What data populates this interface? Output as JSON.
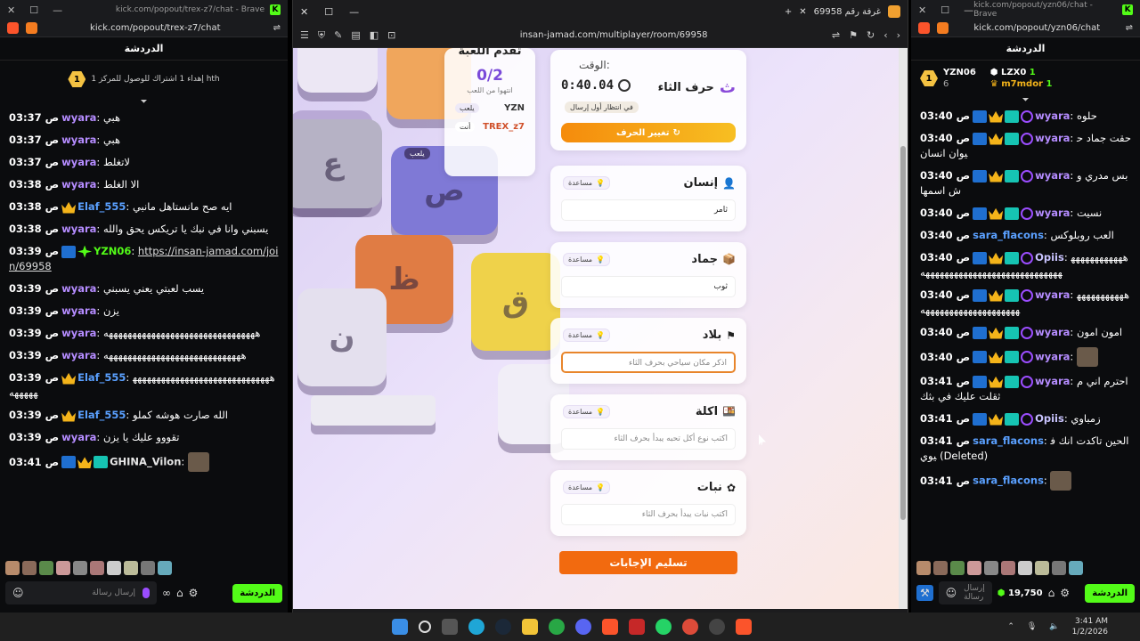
{
  "left_chat": {
    "window_title": "kick.com/popout/trex-z7/chat - Brave",
    "url": "kick.com/popout/trex-z7/chat",
    "header": "الدردشة",
    "pinned_rank": "1",
    "pinned_text": "إهداء 1 اشتراك للوصول للمركز 1 hth",
    "messages": [
      {
        "time": "03:37 ص",
        "user": "wyara",
        "text": "هبي"
      },
      {
        "time": "03:37 ص",
        "user": "wyara",
        "text": "هبي"
      },
      {
        "time": "03:37 ص",
        "user": "wyara",
        "text": "لاتغلط"
      },
      {
        "time": "03:38 ص",
        "user": "wyara",
        "text": "الا الغلط"
      },
      {
        "time": "03:38 ص",
        "user": "Elaf_555",
        "text": "ايه صح مانستاهل مانبي"
      },
      {
        "time": "03:38 ص",
        "user": "wyara",
        "text": "يسبني وانا في نبك يا تريكس يحق والله"
      },
      {
        "time": "03:39 ص",
        "user": "YZN06",
        "text": "https://insan-jamad.com/join/69958"
      },
      {
        "time": "03:39 ص",
        "user": "wyara",
        "text": "يسب لعبتي يعني يسبني"
      },
      {
        "time": "03:39 ص",
        "user": "wyara",
        "text": "يزن"
      },
      {
        "time": "03:39 ص",
        "user": "wyara",
        "text": "ههههههههههههههههههههههههههههههههه"
      },
      {
        "time": "03:39 ص",
        "user": "wyara",
        "text": "هههههههههههههههههههههههههههههه"
      },
      {
        "time": "03:39 ص",
        "user": "Elaf_555",
        "text": "هههههههههههههههههههههههههههههههههههه"
      },
      {
        "time": "03:39 ص",
        "user": "Elaf_555",
        "text": "الله صارت هوشه كملو"
      },
      {
        "time": "03:39 ص",
        "user": "wyara",
        "text": "تقووو عليك يا يزن"
      },
      {
        "time": "03:41 ص",
        "user": "GHINA_Vilon",
        "text": ""
      }
    ],
    "input_placeholder": "إرسال رسالة",
    "send_label": "الدردشة"
  },
  "browser": {
    "tab_title": "غرفة رقم 69958",
    "address": "insan-jamad.com/multiplayer/room/69958"
  },
  "game": {
    "progress_title": "تقدم اللعبة",
    "progress_score": "0/2",
    "progress_sub": "انتهوا من اللعب",
    "players": [
      {
        "name": "YZN",
        "status": "يلعب"
      },
      {
        "name": "TREX_z7",
        "status": "أنت"
      }
    ],
    "floating_status": "يلعب",
    "time_label": "الوقت:",
    "time_value": "0:40.04",
    "letter_title": "حرف الثاء",
    "letter_glyph": "ث",
    "waiting_text": "في انتظار أول إرسال",
    "change_letter": "تغيير الحرف",
    "help_label": "مساعدة",
    "categories": [
      {
        "title": "إنسان",
        "icon": "person-icon",
        "value": "ثامر",
        "placeholder": ""
      },
      {
        "title": "جماد",
        "icon": "box-icon",
        "value": "ثوب",
        "placeholder": ""
      },
      {
        "title": "بلاد",
        "icon": "flag-icon",
        "value": "",
        "placeholder": "اذكر مكان سياحي بحرف الثاء"
      },
      {
        "title": "اكلة",
        "icon": "food-icon",
        "value": "",
        "placeholder": "اكتب نوع أكل تحبه يبدأ بحرف الثاء"
      },
      {
        "title": "نبات",
        "icon": "plant-icon",
        "value": "",
        "placeholder": "اكتب نبات يبدأ بحرف الثاء"
      }
    ],
    "submit_label": "تسليم الإجابات",
    "key_letters": [
      "ع",
      "ص",
      "ظ",
      "ق",
      "ن"
    ]
  },
  "right_chat": {
    "window_title": "kick.com/popout/yzn06/chat - Brave",
    "url": "kick.com/popout/yzn06/chat",
    "header": "الدردشة",
    "leaderboard": [
      {
        "rank": "1",
        "name": "YZN06",
        "count": "6"
      },
      {
        "name": "LZX0",
        "count": "1"
      },
      {
        "name": "m7mdor",
        "count": "1"
      }
    ],
    "messages": [
      {
        "time": "03:40 ص",
        "user": "wyara",
        "text": "حلوه"
      },
      {
        "time": "03:40 ص",
        "user": "wyara",
        "text": "حقت جماد حيوان انسان"
      },
      {
        "time": "03:40 ص",
        "user": "wyara",
        "text": "بس مدري وش اسمها"
      },
      {
        "time": "03:40 ص",
        "user": "wyara",
        "text": "نسيت"
      },
      {
        "time": "03:40 ص",
        "user": "sara_flacons",
        "text": "العب روبلوكس"
      },
      {
        "time": "03:40 ص",
        "user": "Opiis",
        "text": "هههههههههههههههههههههههههههههههههههههههههه"
      },
      {
        "time": "03:40 ص",
        "user": "wyara",
        "text": "هههههههههههههههههههههههههههههههه"
      },
      {
        "time": "03:40 ص",
        "user": "wyara",
        "text": "امون امون"
      },
      {
        "time": "03:40 ص",
        "user": "wyara",
        "text": ""
      },
      {
        "time": "03:41 ص",
        "user": "wyara",
        "text": "احترم اني م ثقلت عليك في بثك"
      },
      {
        "time": "03:41 ص",
        "user": "Opiis",
        "text": "زمباوي"
      },
      {
        "time": "03:41 ص",
        "user": "sara_flacons",
        "text": "الحين تاكدت انك فيوي (Deleted)"
      },
      {
        "time": "03:41 ص",
        "user": "sara_flacons",
        "text": ""
      }
    ],
    "input_placeholder": "إرسال رسالة",
    "points": "19,750",
    "send_label": "الدردشة"
  },
  "taskbar": {
    "time": "3:41 AM",
    "date": "1/2/2026"
  }
}
